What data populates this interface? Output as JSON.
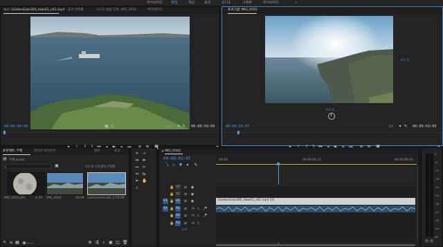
{
  "workspaces": [
    "라이브러리",
    "편집",
    "색상",
    "효과",
    "오디오",
    "그래픽",
    "라이브러리"
  ],
  "workspace_menu": "»",
  "source": {
    "tabs": [
      "소스: GoldenGate360_take01_v01.mp4",
      "효과 컨트롤",
      "오디오 클립 믹서: IMG_0502",
      "메타데이터"
    ],
    "timecode_in": "00:00:00:00",
    "fit": "1/2",
    "timecode_dur": "00:00:59:09"
  },
  "program": {
    "tabs": [
      "프로그램: IMG_0502"
    ],
    "timecode_in": "00:00:03:07",
    "fit": "1/2",
    "timecode_dur": "00:00:59:09",
    "vr_yaw": "0.0 도",
    "vr_pitch": "0.0 도"
  },
  "project": {
    "tabs": [
      "프로젝트: 무제",
      "미디어 브라우저",
      "정보",
      "효과"
    ],
    "name": "무제.prproj",
    "search_placeholder": "",
    "selection": "1/3 중 1개 항목 선택함",
    "items": [
      {
        "name": "IMG_0502.JPG",
        "dur": "4:29"
      },
      {
        "name": "IMG_0502",
        "dur": "59:09"
      },
      {
        "name": "GoldenGate360_take01_v01",
        "dur": "59:09"
      }
    ]
  },
  "timeline": {
    "tab": "IMG_0502",
    "timecode": "00:00:03:07",
    "ruler": [
      ":00:00",
      "00:00:04:23",
      "00:00:09:23"
    ],
    "video_tracks": [
      "V3",
      "V2",
      "V1"
    ],
    "audio_tracks": [
      "A1",
      "A2",
      "A3"
    ],
    "source_patch_v": "V1",
    "source_patch_a": "A1",
    "clip_label": "GoldenGate360_take01_v01.mp4 [V]",
    "master": "0.0"
  },
  "meter": {
    "scale": [
      "0",
      "-6",
      "-12",
      "-18",
      "-24",
      "-30",
      "-36",
      "-42",
      "-48",
      "-54",
      "dB"
    ],
    "level": 0.0,
    "solo": "S",
    "solo2": "S"
  },
  "colors": {
    "accent": "#4a86c8",
    "timecode": "#4a9ae8",
    "clip_video": "#d0d0d0",
    "audio_wave": "#5f8fb5"
  }
}
